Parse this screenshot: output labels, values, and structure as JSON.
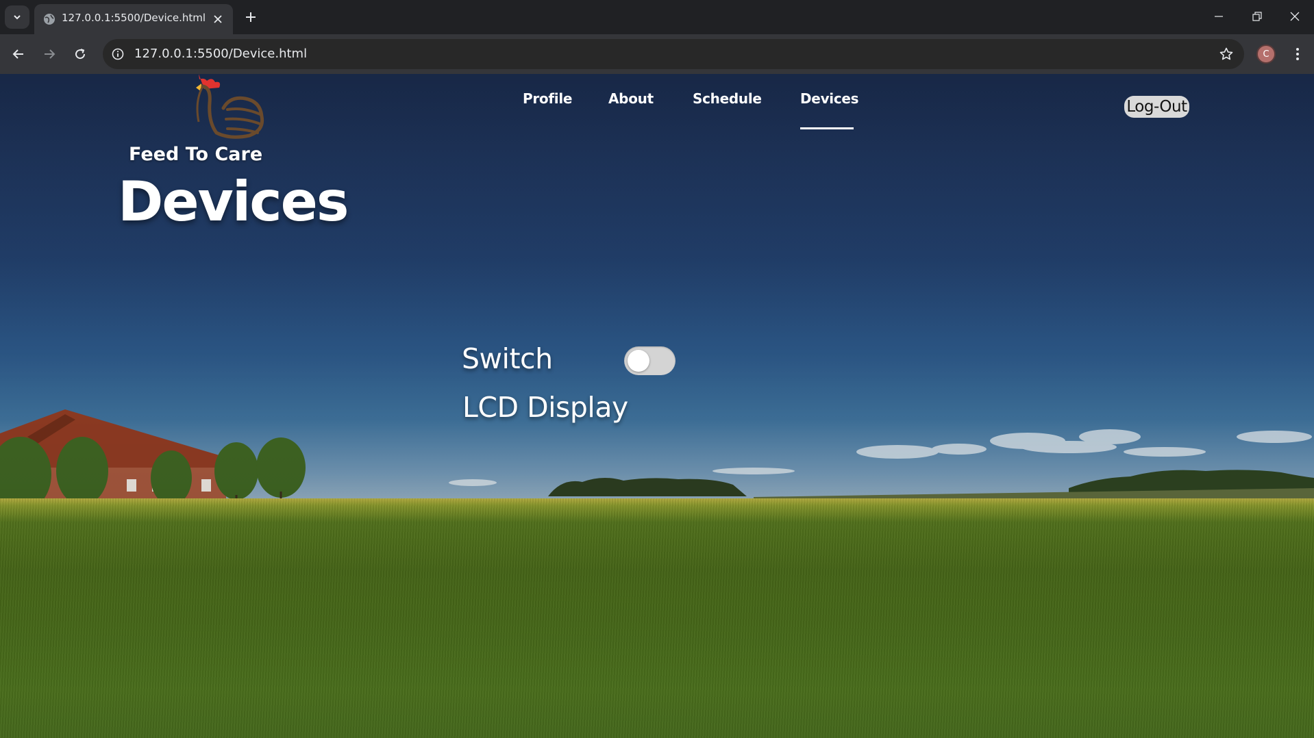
{
  "browser": {
    "tab_title": "127.0.0.1:5500/Device.html",
    "url": "127.0.0.1:5500/Device.html",
    "profile_initial": "C",
    "icons": [
      "tab-list-icon",
      "globe-icon",
      "close-icon",
      "plus-icon",
      "minimize-icon",
      "restore-icon",
      "window-close-icon",
      "back-icon",
      "forward-icon",
      "reload-icon",
      "info-icon",
      "star-icon",
      "kebab-menu-icon"
    ]
  },
  "site": {
    "brand": "Feed To Care",
    "nav": [
      {
        "label": "Profile"
      },
      {
        "label": "About"
      },
      {
        "label": "Schedule"
      },
      {
        "label": "Devices",
        "active": true
      }
    ],
    "logout_label": "Log-Out"
  },
  "main": {
    "title": "Devices",
    "devices": [
      {
        "label": "Switch",
        "control": "toggle",
        "on": false
      },
      {
        "label": "LCD Display"
      }
    ]
  },
  "colors": {
    "chrome_dark": "#202124",
    "chrome_toolbar": "#35363a",
    "sky_top": "#1c2e50",
    "field": "#4a6b19",
    "toggle_off": "#d4d4d4",
    "logout_bg": "#d9d9d9"
  }
}
